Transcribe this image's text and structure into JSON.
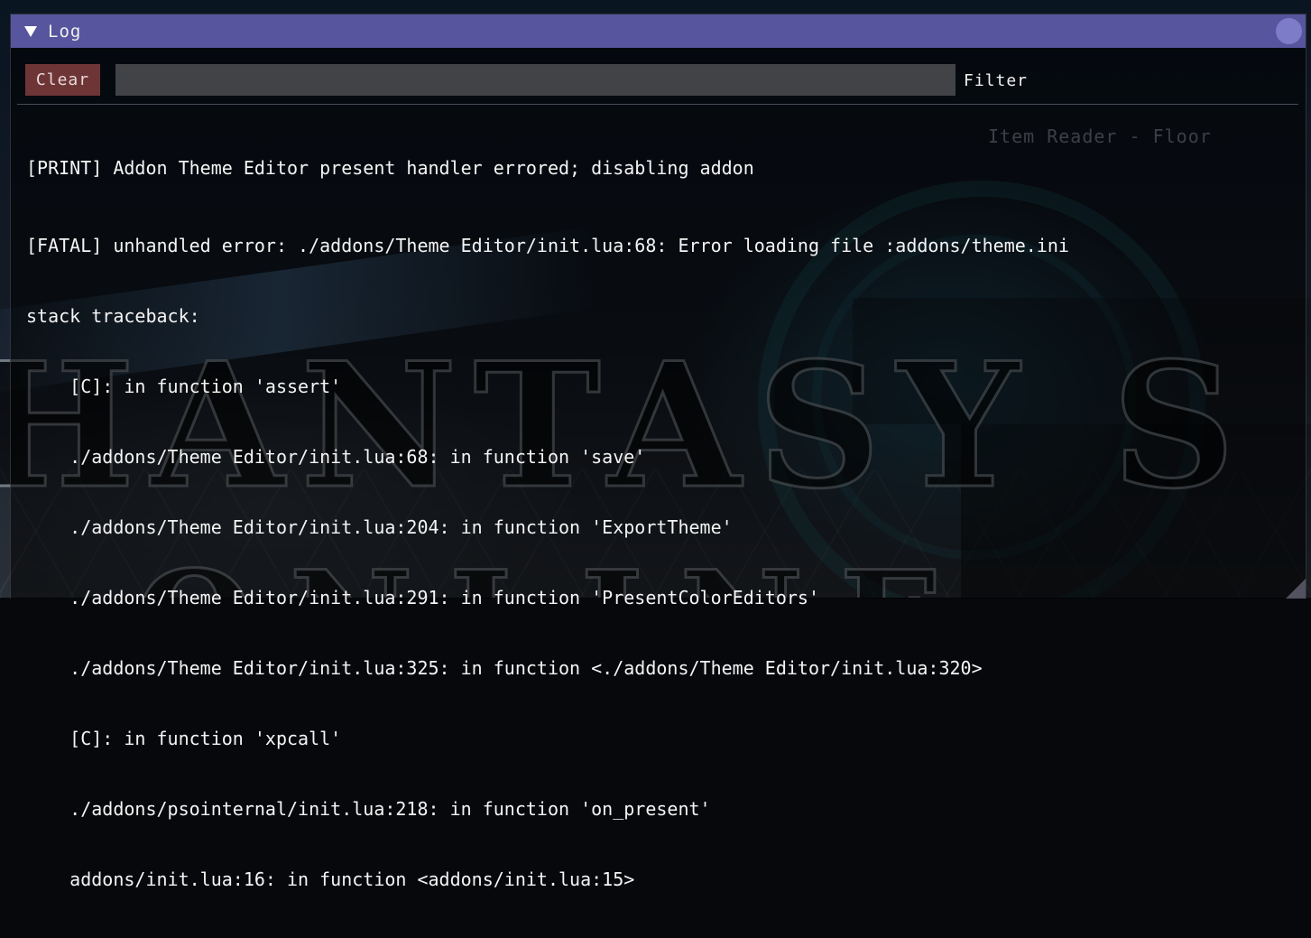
{
  "window": {
    "title": "Log"
  },
  "toolbar": {
    "clear_label": "Clear",
    "filter_value": "",
    "filter_label": "Filter"
  },
  "background": {
    "ghost_window_title": "Item Reader - Floor"
  },
  "log": {
    "lines": [
      "[PRINT] Addon Theme Editor present handler errored; disabling addon",
      "[FATAL] unhandled error: ./addons/Theme Editor/init.lua:68: Error loading file :addons/theme.ini",
      "stack traceback:",
      "    [C]: in function 'assert'",
      "    ./addons/Theme Editor/init.lua:68: in function 'save'",
      "    ./addons/Theme Editor/init.lua:204: in function 'ExportTheme'",
      "    ./addons/Theme Editor/init.lua:291: in function 'PresentColorEditors'",
      "    ./addons/Theme Editor/init.lua:325: in function <./addons/Theme Editor/init.lua:320>",
      "    [C]: in function 'xpcall'",
      "    ./addons/psointernal/init.lua:218: in function 'on_present'",
      "    addons/init.lua:16: in function <addons/init.lua:15>"
    ]
  },
  "colors": {
    "titlebar": "#56559d",
    "clear_button": "#6e3537",
    "filter_field": "#505054"
  }
}
